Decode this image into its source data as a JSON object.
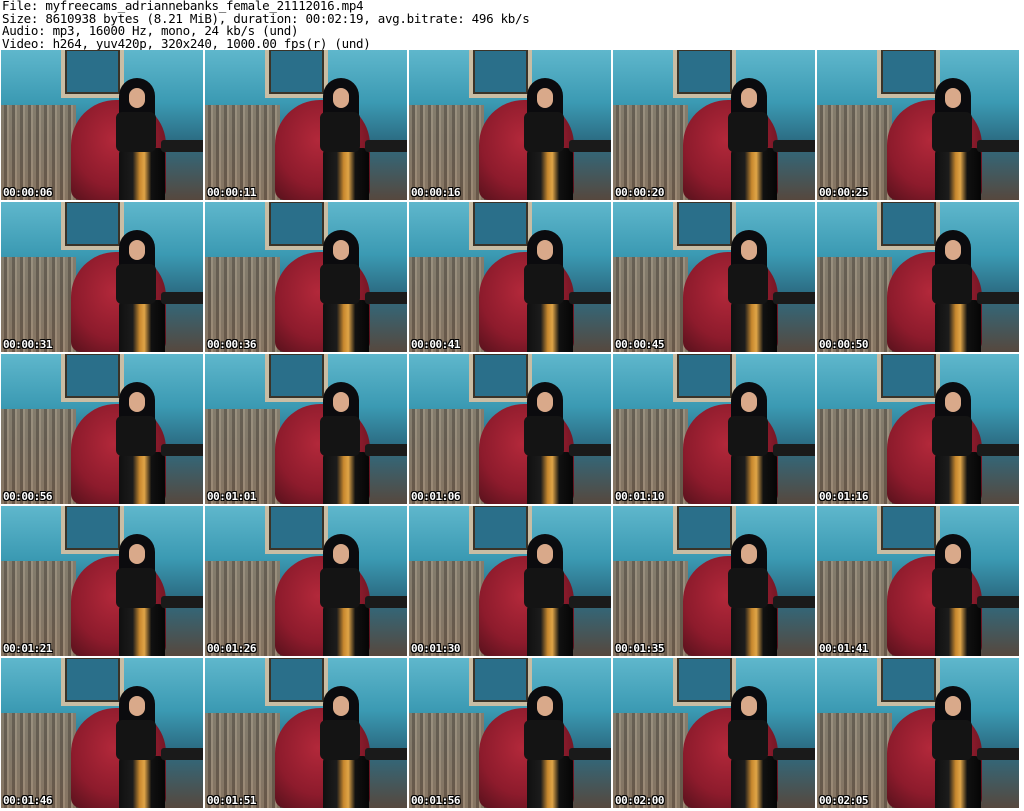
{
  "header": {
    "file": "File: myfreecams_adriannebanks_female_21112016.mp4",
    "size": "Size: 8610938 bytes (8.21 MiB), duration: 00:02:19, avg.bitrate: 496 kb/s",
    "audio": "Audio: mp3, 16000 Hz, mono, 24 kb/s (und)",
    "video": "Video: h264, yuv420p, 320x240, 1000.00 fps(r) (und)"
  },
  "thumbnails": [
    "00:00:06",
    "00:00:11",
    "00:00:16",
    "00:00:20",
    "00:00:25",
    "00:00:31",
    "00:00:36",
    "00:00:41",
    "00:00:45",
    "00:00:50",
    "00:00:56",
    "00:01:01",
    "00:01:06",
    "00:01:10",
    "00:01:16",
    "00:01:21",
    "00:01:26",
    "00:01:30",
    "00:01:35",
    "00:01:41",
    "00:01:46",
    "00:01:51",
    "00:01:56",
    "00:02:00",
    "00:02:05"
  ]
}
